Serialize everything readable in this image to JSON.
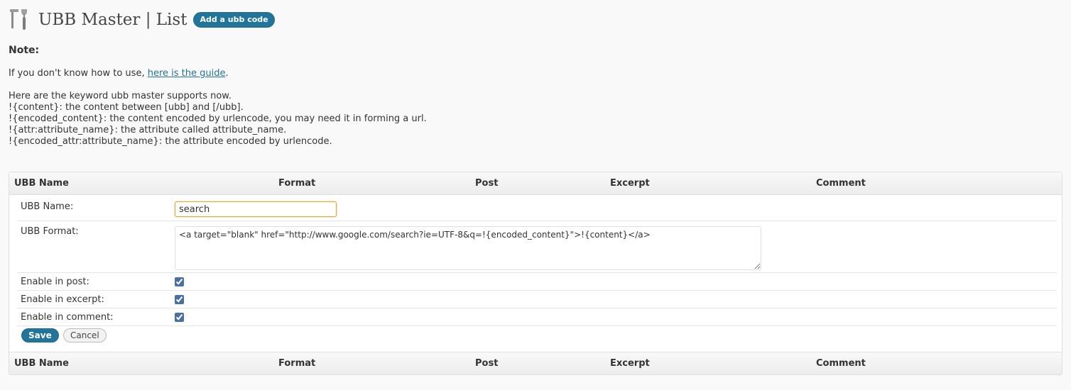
{
  "header": {
    "title": "UBB Master | List",
    "add_button": "Add a ubb code",
    "icon": "tools-icon"
  },
  "note": {
    "title": "Note:",
    "guide_prefix": "If you don't know how to use, ",
    "guide_link": "here is the guide",
    "guide_suffix": ".",
    "keywords": [
      "Here are the keyword ubb master supports now.",
      "!{content}: the content between [ubb] and [/ubb].",
      "!{encoded_content}: the content encoded by urlencode, you may need it in forming a url.",
      "!{attr:attribute_name}: the attribute called attribute_name.",
      "!{encoded_attr:attribute_name}: the attribute encoded by urlencode."
    ]
  },
  "table": {
    "columns": [
      "UBB Name",
      "Format",
      "Post",
      "Excerpt",
      "Comment"
    ]
  },
  "form": {
    "name_label": "UBB Name:",
    "name_value": "search",
    "format_label": "UBB Format:",
    "format_value": "<a target=\"blank\" href=\"http://www.google.com/search?ie=UTF-8&q=!{encoded_content}\">!{content}</a>",
    "post_label": "Enable in post:",
    "post_checked": true,
    "excerpt_label": "Enable in excerpt:",
    "excerpt_checked": true,
    "comment_label": "Enable in comment:",
    "comment_checked": true,
    "save_label": "Save",
    "cancel_label": "Cancel"
  }
}
